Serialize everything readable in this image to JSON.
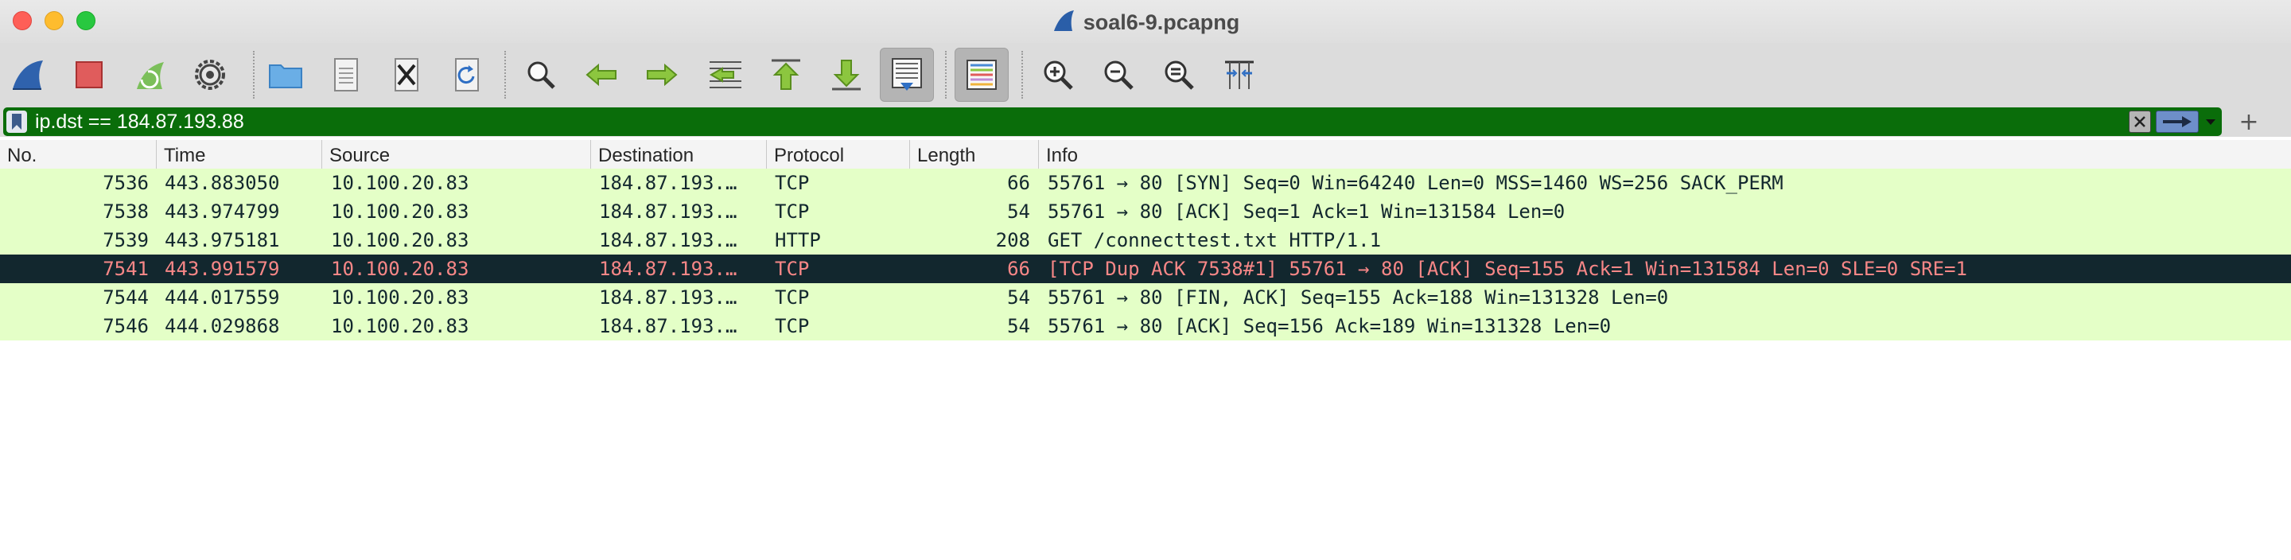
{
  "window": {
    "title": "soal6-9.pcapng",
    "title_icon": "shark-fin-icon"
  },
  "toolbar": {
    "buttons": [
      {
        "name": "start-capture",
        "icon": "shark-fin-icon"
      },
      {
        "name": "stop-capture",
        "icon": "stop-square-icon"
      },
      {
        "name": "restart-capture",
        "icon": "restart-fin-icon"
      },
      {
        "name": "capture-options",
        "icon": "gear-icon"
      },
      {
        "name": "open-file",
        "icon": "folder-icon"
      },
      {
        "name": "save-file",
        "icon": "document-icon"
      },
      {
        "name": "close-file",
        "icon": "close-document-icon"
      },
      {
        "name": "reload-file",
        "icon": "reload-icon"
      },
      {
        "name": "find-packet",
        "icon": "magnifier-icon"
      },
      {
        "name": "go-back",
        "icon": "arrow-left-icon"
      },
      {
        "name": "go-forward",
        "icon": "arrow-right-icon"
      },
      {
        "name": "go-to-packet",
        "icon": "go-to-packet-icon"
      },
      {
        "name": "go-first",
        "icon": "arrow-up-icon"
      },
      {
        "name": "go-last",
        "icon": "arrow-down-icon"
      },
      {
        "name": "auto-scroll",
        "icon": "auto-scroll-icon",
        "pressed": true
      },
      {
        "name": "colorize",
        "icon": "colorize-lines-icon",
        "pressed": true
      },
      {
        "name": "zoom-in",
        "icon": "zoom-in-icon"
      },
      {
        "name": "zoom-out",
        "icon": "zoom-out-icon"
      },
      {
        "name": "normal-size",
        "icon": "zoom-reset-icon"
      },
      {
        "name": "resize-columns",
        "icon": "resize-columns-icon"
      }
    ]
  },
  "filter": {
    "value": "ip.dst == 184.87.193.88",
    "color": "#0a6d0a"
  },
  "columns": [
    "No.",
    "Time",
    "Source",
    "Destination",
    "Protocol",
    "Length",
    "Info"
  ],
  "rows": [
    {
      "no": "7536",
      "time": "443.883050",
      "source": "10.100.20.83",
      "destination": "184.87.193.…",
      "protocol": "TCP",
      "length": "66",
      "info": "55761 → 80 [SYN] Seq=0 Win=64240 Len=0 MSS=1460 WS=256 SACK_PERM"
    },
    {
      "no": "7538",
      "time": "443.974799",
      "source": "10.100.20.83",
      "destination": "184.87.193.…",
      "protocol": "TCP",
      "length": "54",
      "info": "55761 → 80 [ACK] Seq=1 Ack=1 Win=131584 Len=0"
    },
    {
      "no": "7539",
      "time": "443.975181",
      "source": "10.100.20.83",
      "destination": "184.87.193.…",
      "protocol": "HTTP",
      "length": "208",
      "info": "GET /connecttest.txt HTTP/1.1"
    },
    {
      "no": "7541",
      "time": "443.991579",
      "source": "10.100.20.83",
      "destination": "184.87.193.…",
      "protocol": "TCP",
      "length": "66",
      "info": "[TCP Dup ACK 7538#1] 55761 → 80 [ACK] Seq=155 Ack=1 Win=131584 Len=0 SLE=0 SRE=1",
      "selected": true
    },
    {
      "no": "7544",
      "time": "444.017559",
      "source": "10.100.20.83",
      "destination": "184.87.193.…",
      "protocol": "TCP",
      "length": "54",
      "info": "55761 → 80 [FIN, ACK] Seq=155 Ack=188 Win=131328 Len=0"
    },
    {
      "no": "7546",
      "time": "444.029868",
      "source": "10.100.20.83",
      "destination": "184.87.193.…",
      "protocol": "TCP",
      "length": "54",
      "info": "55761 → 80 [ACK] Seq=156 Ack=189 Win=131328 Len=0"
    }
  ],
  "colors": {
    "row_tcp_bg": "#e4ffc7",
    "selected_bg": "#12272e",
    "selected_fg": "#f78787",
    "filter_valid": "#0a6d0a"
  }
}
